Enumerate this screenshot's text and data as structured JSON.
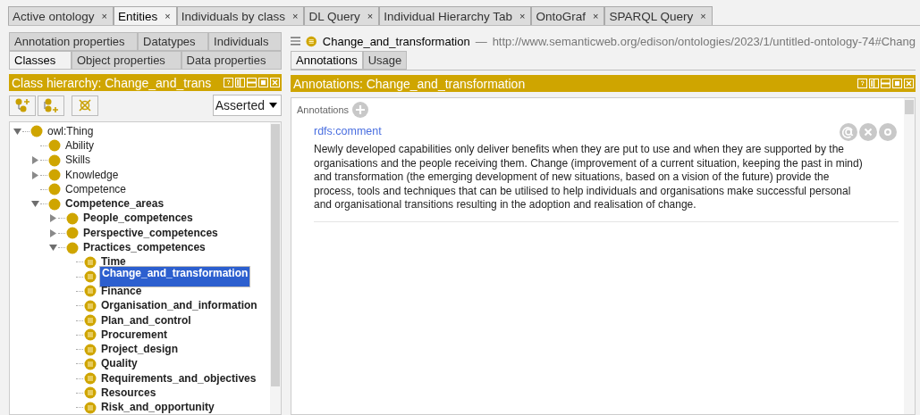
{
  "main_tabs": [
    {
      "label": "Active ontology",
      "close": "×",
      "selected": false
    },
    {
      "label": "Entities",
      "close": "×",
      "selected": true
    },
    {
      "label": "Individuals by class",
      "close": "×",
      "selected": false
    },
    {
      "label": "DL Query",
      "close": "×",
      "selected": false
    },
    {
      "label": "Individual Hierarchy Tab",
      "close": "×",
      "selected": false
    },
    {
      "label": "OntoGraf",
      "close": "×",
      "selected": false
    },
    {
      "label": "SPARQL Query",
      "close": "×",
      "selected": false
    }
  ],
  "entity_tabs": [
    [
      {
        "label": "Annotation properties",
        "selected": false
      },
      {
        "label": "Datatypes",
        "selected": false
      },
      {
        "label": "Individuals",
        "selected": false
      }
    ],
    [
      {
        "label": "Classes",
        "selected": true
      },
      {
        "label": "Object properties",
        "selected": false
      },
      {
        "label": "Data properties",
        "selected": false
      }
    ]
  ],
  "class_hierarchy": {
    "title": "Class hierarchy: Change_and_trans",
    "view_select": "Asserted",
    "tree": [
      {
        "label": "owl:Thing",
        "kind": "class",
        "expandable": true,
        "expanded": true,
        "bold": false,
        "selected": false,
        "children": [
          {
            "label": "Ability",
            "kind": "class",
            "expandable": false,
            "bold": false,
            "selected": false
          },
          {
            "label": "Skills",
            "kind": "class",
            "expandable": true,
            "expanded": false,
            "bold": false,
            "selected": false
          },
          {
            "label": "Knowledge",
            "kind": "class",
            "expandable": true,
            "expanded": false,
            "bold": false,
            "selected": false
          },
          {
            "label": "Competence",
            "kind": "class",
            "expandable": false,
            "bold": false,
            "selected": false
          },
          {
            "label": "Competence_areas",
            "kind": "class",
            "expandable": true,
            "expanded": true,
            "bold": true,
            "selected": false,
            "children": [
              {
                "label": "People_competences",
                "kind": "class",
                "expandable": true,
                "expanded": false,
                "bold": true,
                "selected": false
              },
              {
                "label": "Perspective_competences",
                "kind": "class",
                "expandable": true,
                "expanded": false,
                "bold": true,
                "selected": false
              },
              {
                "label": "Practices_competences",
                "kind": "class",
                "expandable": true,
                "expanded": true,
                "bold": true,
                "selected": false,
                "children": [
                  {
                    "label": "Time",
                    "kind": "defined",
                    "expandable": false,
                    "bold": true,
                    "selected": false
                  },
                  {
                    "label": "Change_and_transformation",
                    "kind": "defined",
                    "expandable": false,
                    "bold": true,
                    "selected": true
                  },
                  {
                    "label": "Finance",
                    "kind": "defined",
                    "expandable": false,
                    "bold": true,
                    "selected": false
                  },
                  {
                    "label": "Organisation_and_information",
                    "kind": "defined",
                    "expandable": false,
                    "bold": true,
                    "selected": false
                  },
                  {
                    "label": "Plan_and_control",
                    "kind": "defined",
                    "expandable": false,
                    "bold": true,
                    "selected": false
                  },
                  {
                    "label": "Procurement",
                    "kind": "defined",
                    "expandable": false,
                    "bold": true,
                    "selected": false
                  },
                  {
                    "label": "Project_design",
                    "kind": "defined",
                    "expandable": false,
                    "bold": true,
                    "selected": false
                  },
                  {
                    "label": "Quality",
                    "kind": "defined",
                    "expandable": false,
                    "bold": true,
                    "selected": false
                  },
                  {
                    "label": "Requirements_and_objectives",
                    "kind": "defined",
                    "expandable": false,
                    "bold": true,
                    "selected": false
                  },
                  {
                    "label": "Resources",
                    "kind": "defined",
                    "expandable": false,
                    "bold": true,
                    "selected": false
                  },
                  {
                    "label": "Risk_and_opportunity",
                    "kind": "defined",
                    "expandable": false,
                    "bold": true,
                    "selected": false
                  }
                ]
              }
            ]
          }
        ]
      }
    ]
  },
  "entity_header": {
    "name": "Change_and_transformation",
    "separator": "—",
    "iri": "http://www.semanticweb.org/edison/ontologies/2023/1/untitled-ontology-74#Chang"
  },
  "view_tabs": [
    {
      "label": "Annotations",
      "selected": true
    },
    {
      "label": "Usage",
      "selected": false
    }
  ],
  "annotations_panel": {
    "title": "Annotations: Change_and_transformation",
    "section_label": "Annotations",
    "annotations": [
      {
        "property": "rdfs:comment",
        "value": "Newly developed capabilities only deliver benefits when they are put to use and when they are supported by the organisations and the people receiving them. Change (improvement of a current situation, keeping the past in mind) and transformation (the emerging development of new situations, based on a vision of the future) provide the process, tools and techniques that can be utilised to help individuals and organisations make successful personal and organisational transitions resulting in the adoption and realisation of change."
      }
    ]
  }
}
